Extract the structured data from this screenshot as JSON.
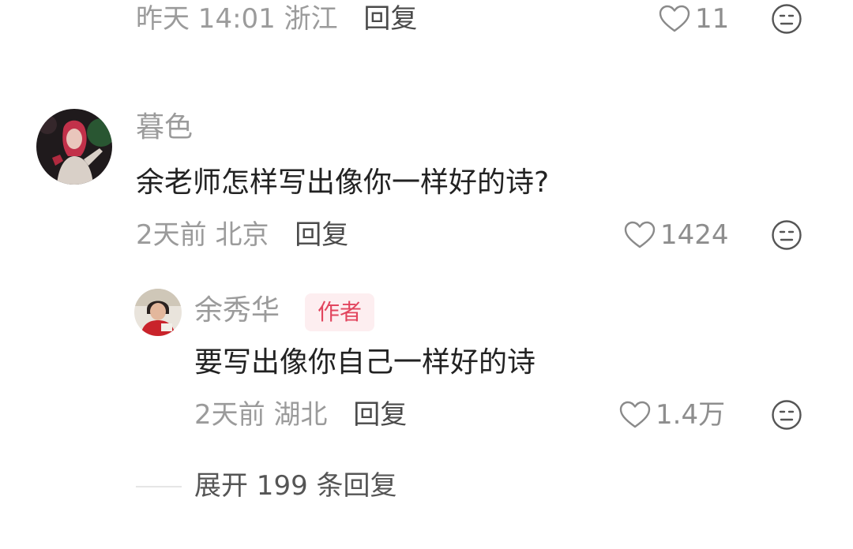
{
  "top_comment": {
    "time": "昨天 14:01",
    "location": "浙江",
    "reply_label": "回复",
    "likes": "11"
  },
  "comment": {
    "username": "暮色",
    "text": "余老师怎样写出像你一样好的诗?",
    "time": "2天前",
    "location": "北京",
    "reply_label": "回复",
    "likes": "1424"
  },
  "reply": {
    "username": "余秀华",
    "badge": "作者",
    "text": "要写出像你自己一样好的诗",
    "time": "2天前",
    "location": "湖北",
    "reply_label": "回复",
    "likes": "1.4万"
  },
  "expand": {
    "label": "展开 199 条回复"
  },
  "icons": {
    "like": "heart-outline-icon",
    "dislike": "frown-face-icon"
  },
  "colors": {
    "author_badge_bg": "#fdeef0",
    "author_badge_text": "#e2455e",
    "meta_text": "#9b9b9b"
  }
}
